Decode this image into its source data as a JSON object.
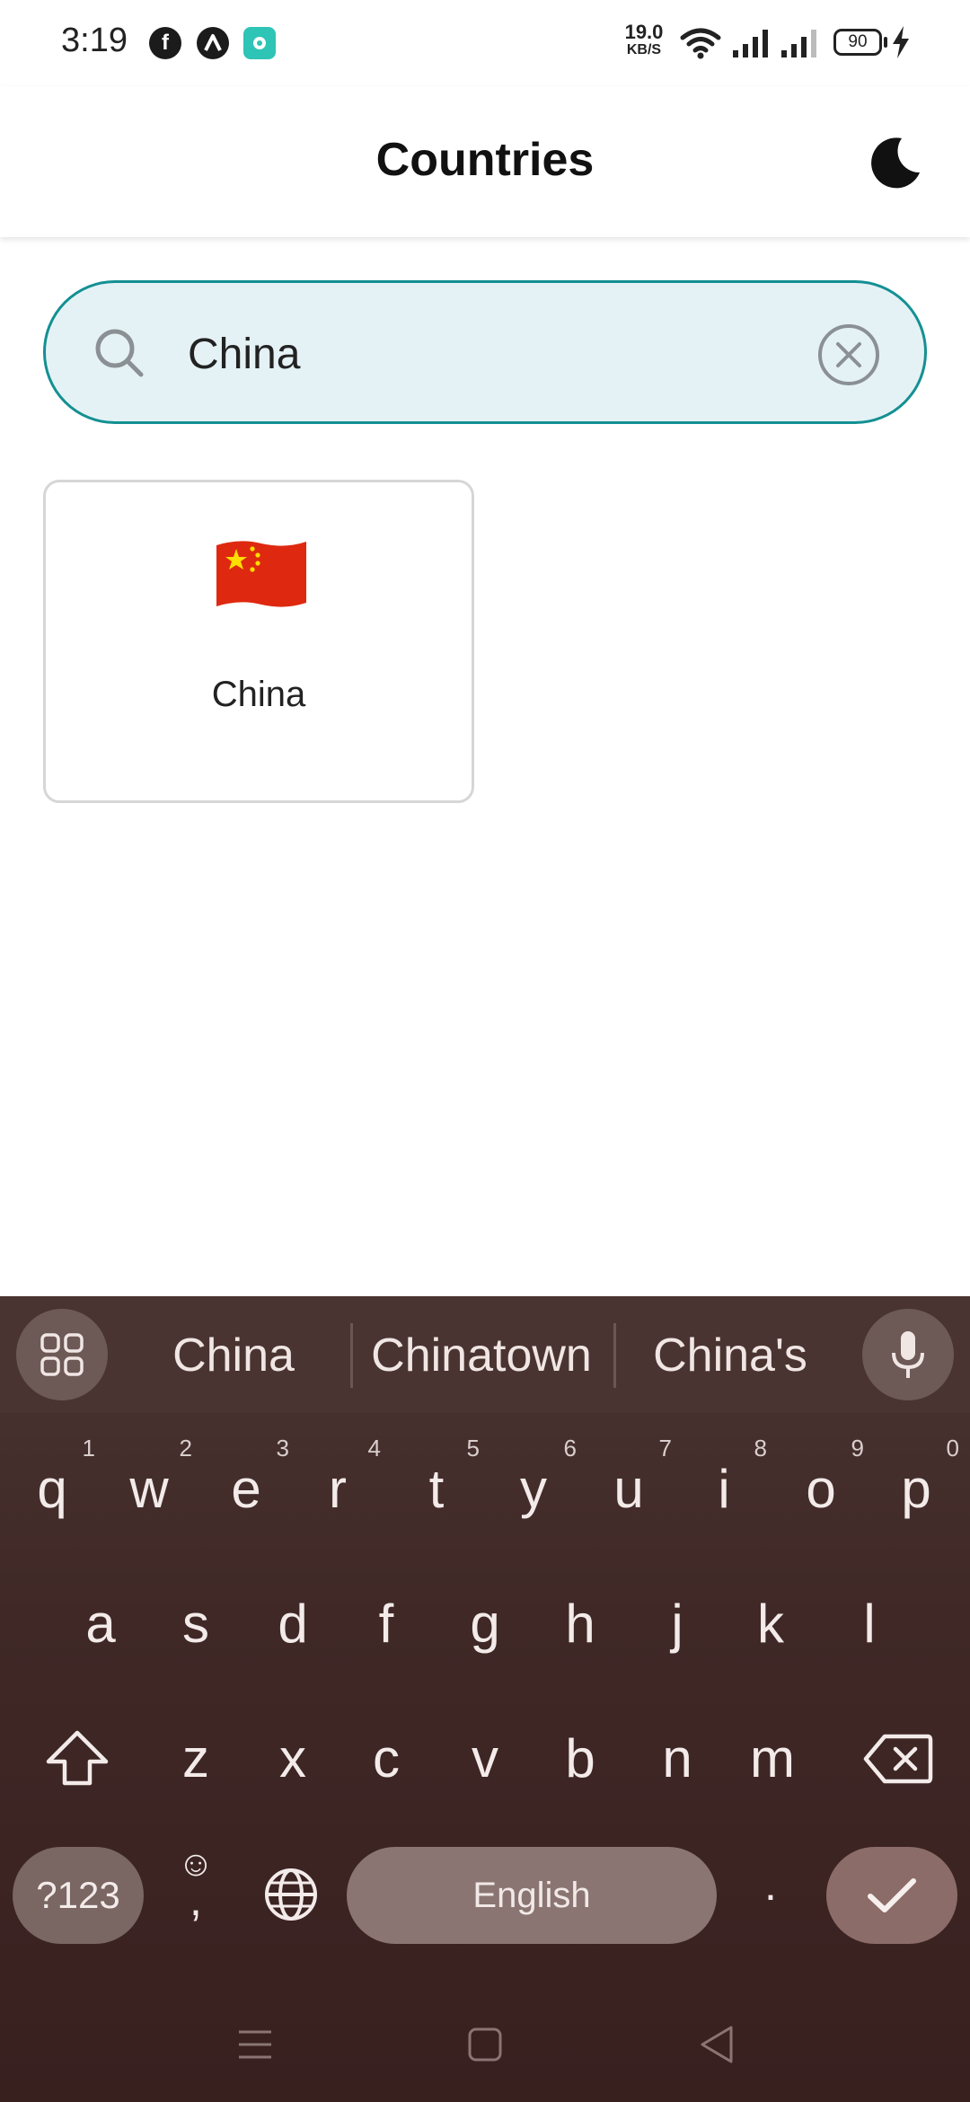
{
  "status_bar": {
    "time": "3:19",
    "net_speed_value": "19.0",
    "net_speed_unit": "KB/S",
    "battery": "90",
    "notification_icons": [
      "facebook-icon",
      "arc-app-icon",
      "music-app-icon"
    ]
  },
  "app_bar": {
    "title": "Countries",
    "theme_toggle_icon": "moon-icon"
  },
  "search": {
    "value": "China",
    "placeholder": "Search"
  },
  "results": [
    {
      "flag": "china-flag-icon",
      "name": "China"
    }
  ],
  "keyboard": {
    "suggestions": [
      "China",
      "Chinatown",
      "China's"
    ],
    "row1": [
      {
        "key": "q",
        "hint": "1"
      },
      {
        "key": "w",
        "hint": "2"
      },
      {
        "key": "e",
        "hint": "3"
      },
      {
        "key": "r",
        "hint": "4"
      },
      {
        "key": "t",
        "hint": "5"
      },
      {
        "key": "y",
        "hint": "6"
      },
      {
        "key": "u",
        "hint": "7"
      },
      {
        "key": "i",
        "hint": "8"
      },
      {
        "key": "o",
        "hint": "9"
      },
      {
        "key": "p",
        "hint": "0"
      }
    ],
    "row2": [
      "a",
      "s",
      "d",
      "f",
      "g",
      "h",
      "j",
      "k",
      "l"
    ],
    "row3": [
      "z",
      "x",
      "c",
      "v",
      "b",
      "n",
      "m"
    ],
    "symbols_label": "?123",
    "emoji_top": "☺",
    "emoji_bottom": ",",
    "space_label": "English",
    "period_label": "."
  },
  "colors": {
    "accent": "#149093",
    "search_bg": "#e5f2f5",
    "keyboard_bg": "#3f2826",
    "flag_red": "#de2910",
    "flag_star": "#ffde00"
  }
}
